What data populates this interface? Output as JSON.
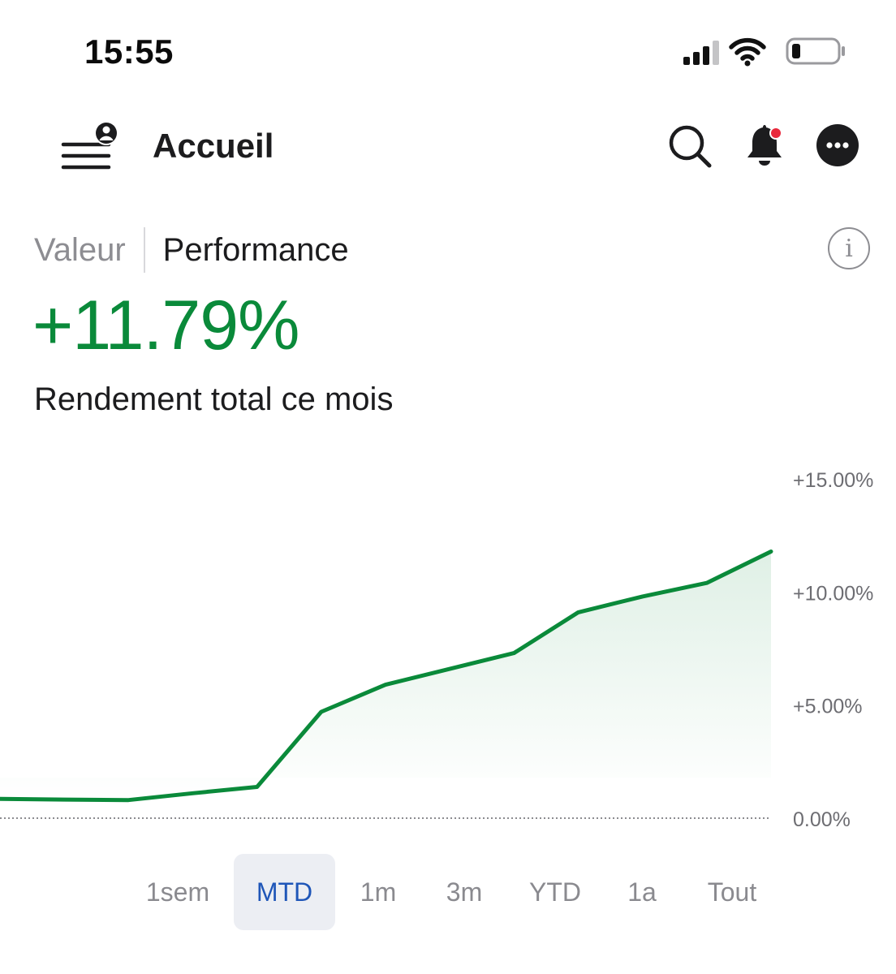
{
  "status_bar": {
    "time": "15:55"
  },
  "header": {
    "title": "Accueil",
    "icons": [
      "menu-profile-icon",
      "search-icon",
      "bell-icon",
      "more-icon"
    ],
    "notification_dot_color": "#e8283b"
  },
  "view_toggle": {
    "options": [
      "Valeur",
      "Performance"
    ],
    "active": "Performance"
  },
  "performance": {
    "value": "+11.79%",
    "caption": "Rendement total ce mois",
    "color": "#0a8a3a"
  },
  "chart_data": {
    "type": "area",
    "title": "",
    "xlabel": "",
    "ylabel": "",
    "x": [
      0,
      1,
      2,
      3,
      4,
      5,
      6,
      7,
      8,
      9,
      10,
      11,
      12
    ],
    "series": [
      {
        "values": [
          0.85,
          0.82,
          0.8,
          1.1,
          1.38,
          4.7,
          5.9,
          6.6,
          7.3,
          9.1,
          9.8,
          10.4,
          11.79
        ]
      }
    ],
    "y_ticks": [
      "+15.00%",
      "+10.00%",
      "+5.00%",
      "0.00%"
    ],
    "ylim": [
      0,
      15
    ],
    "baseline": 0,
    "grid": false,
    "line_color": "#0a8a3a"
  },
  "ranges": {
    "items": [
      "1sem",
      "MTD",
      "1m",
      "3m",
      "YTD",
      "1a",
      "Tout"
    ],
    "selected": "MTD"
  }
}
